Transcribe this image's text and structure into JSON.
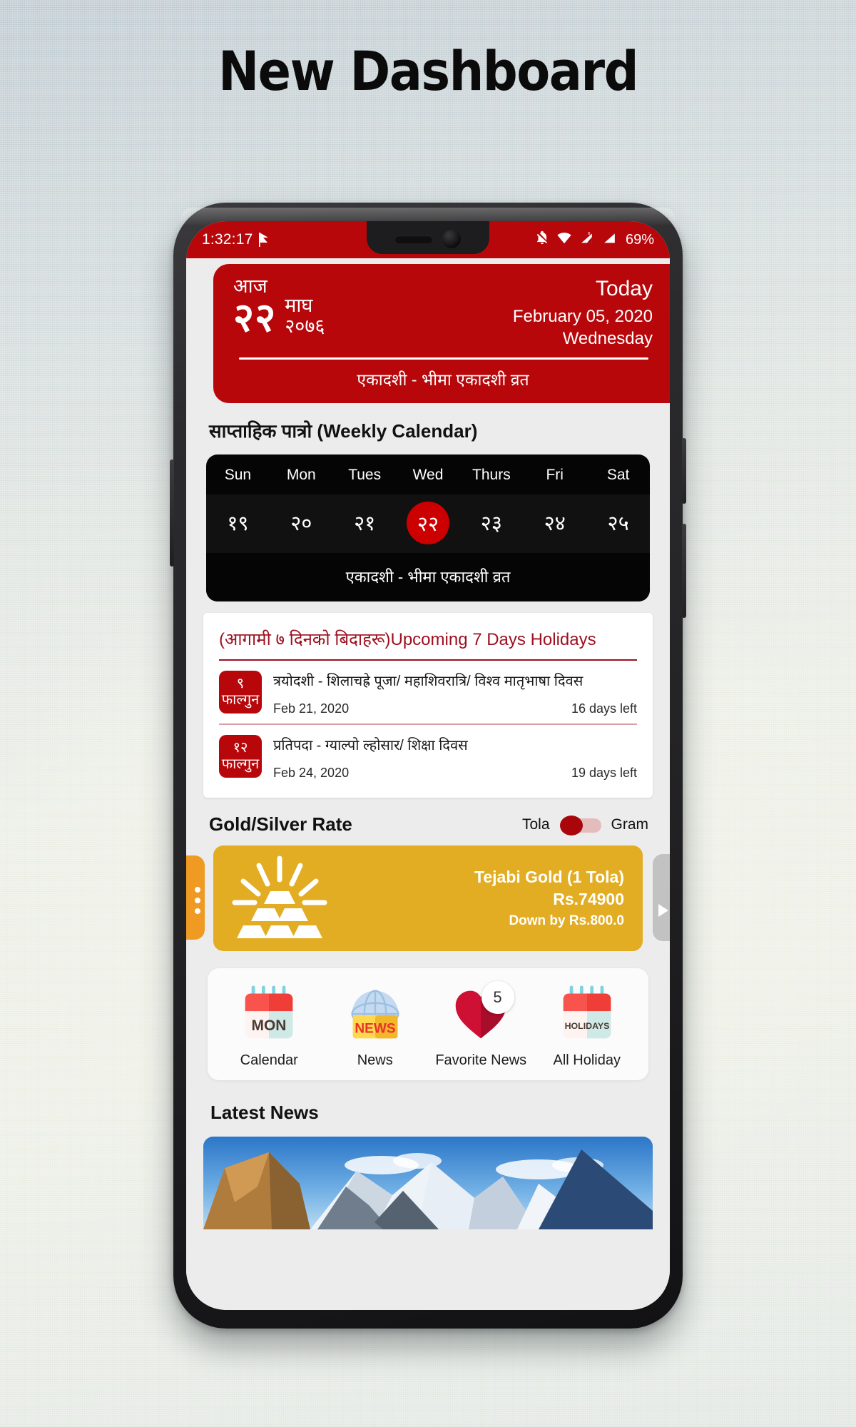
{
  "headline": "New Dashboard",
  "statusbar": {
    "clock": "1:32:17",
    "flag_icon": "nepal-flag-icon",
    "icons": [
      "bell-off-icon",
      "wifi-icon",
      "signal-no-sim-icon",
      "signal-icon"
    ],
    "battery": "69%"
  },
  "today": {
    "aaj_label": "आज",
    "np_day": "२२",
    "np_month": "माघ",
    "np_year": "२०७६",
    "today_label": "Today",
    "en_date": "February 05, 2020",
    "weekday": "Wednesday",
    "tithi": "एकादशी - भीमा एकादशी व्रत"
  },
  "weekly": {
    "section_title": "साप्ताहिक पात्रो (Weekly Calendar)",
    "day_names": [
      "Sun",
      "Mon",
      "Tues",
      "Wed",
      "Thurs",
      "Fri",
      "Sat"
    ],
    "dates": [
      "१९",
      "२०",
      "२१",
      "२२",
      "२३",
      "२४",
      "२५"
    ],
    "active_index": 3,
    "note": "एकादशी - भीमा एकादशी व्रत",
    "accent_color": "#cc0000"
  },
  "holidays": {
    "title": "(आगामी ७ दिनको बिदाहरू)Upcoming 7 Days Holidays",
    "accent_color": "#9d1020",
    "items": [
      {
        "badge_day": "९",
        "badge_month": "फाल्गुन",
        "name": "त्रयोदशी - शिलाचह्रे पूजा/ महाशिवरात्रि/ विश्व मातृभाषा दिवस",
        "date": "Feb 21, 2020",
        "days_left": "16 days left"
      },
      {
        "badge_day": "१२",
        "badge_month": "फाल्गुन",
        "name": "प्रतिपदा - ग्याल्पो ल्होसार/ शिक्षा दिवस",
        "date": "Feb 24, 2020",
        "days_left": "19 days left"
      }
    ]
  },
  "gold_silver": {
    "title": "Gold/Silver Rate",
    "unit_left": "Tola",
    "unit_right": "Gram",
    "selected_unit": "Tola",
    "card": {
      "name": "Tejabi Gold (1 Tola)",
      "price": "Rs.74900",
      "change": "Down by Rs.800.0",
      "color": "#e2ad23",
      "icon": "gold-bars-icon"
    },
    "peek_left_color": "#ef9a22",
    "peek_right_color": "#c2c2c2"
  },
  "quick_actions": [
    {
      "icon": "calendar-mon-icon",
      "icon_text": "MON",
      "label": "Calendar"
    },
    {
      "icon": "news-globe-icon",
      "icon_text": "NEWS",
      "label": "News"
    },
    {
      "icon": "heart-icon",
      "icon_text": "",
      "label": "Favorite News",
      "badge": "5"
    },
    {
      "icon": "calendar-holidays-icon",
      "icon_text": "HOLIDAYS",
      "label": "All Holiday"
    }
  ],
  "latest_news": {
    "title": "Latest News",
    "image_alt": "snow-mountain-photo"
  }
}
